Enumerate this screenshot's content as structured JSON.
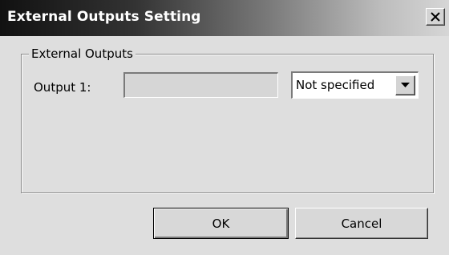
{
  "window": {
    "title": "External Outputs Setting",
    "close_icon": "close-x-icon"
  },
  "group": {
    "legend": "External Outputs"
  },
  "output1": {
    "label": "Output 1:",
    "value": "",
    "select": {
      "selected": "Not specified",
      "arrow_icon": "dropdown-arrow-icon"
    }
  },
  "buttons": {
    "ok": "OK",
    "cancel": "Cancel"
  },
  "colors": {
    "title_gradient_start": "#111111",
    "title_gradient_end": "#d6d6d6",
    "dialog_background": "#dedede"
  }
}
